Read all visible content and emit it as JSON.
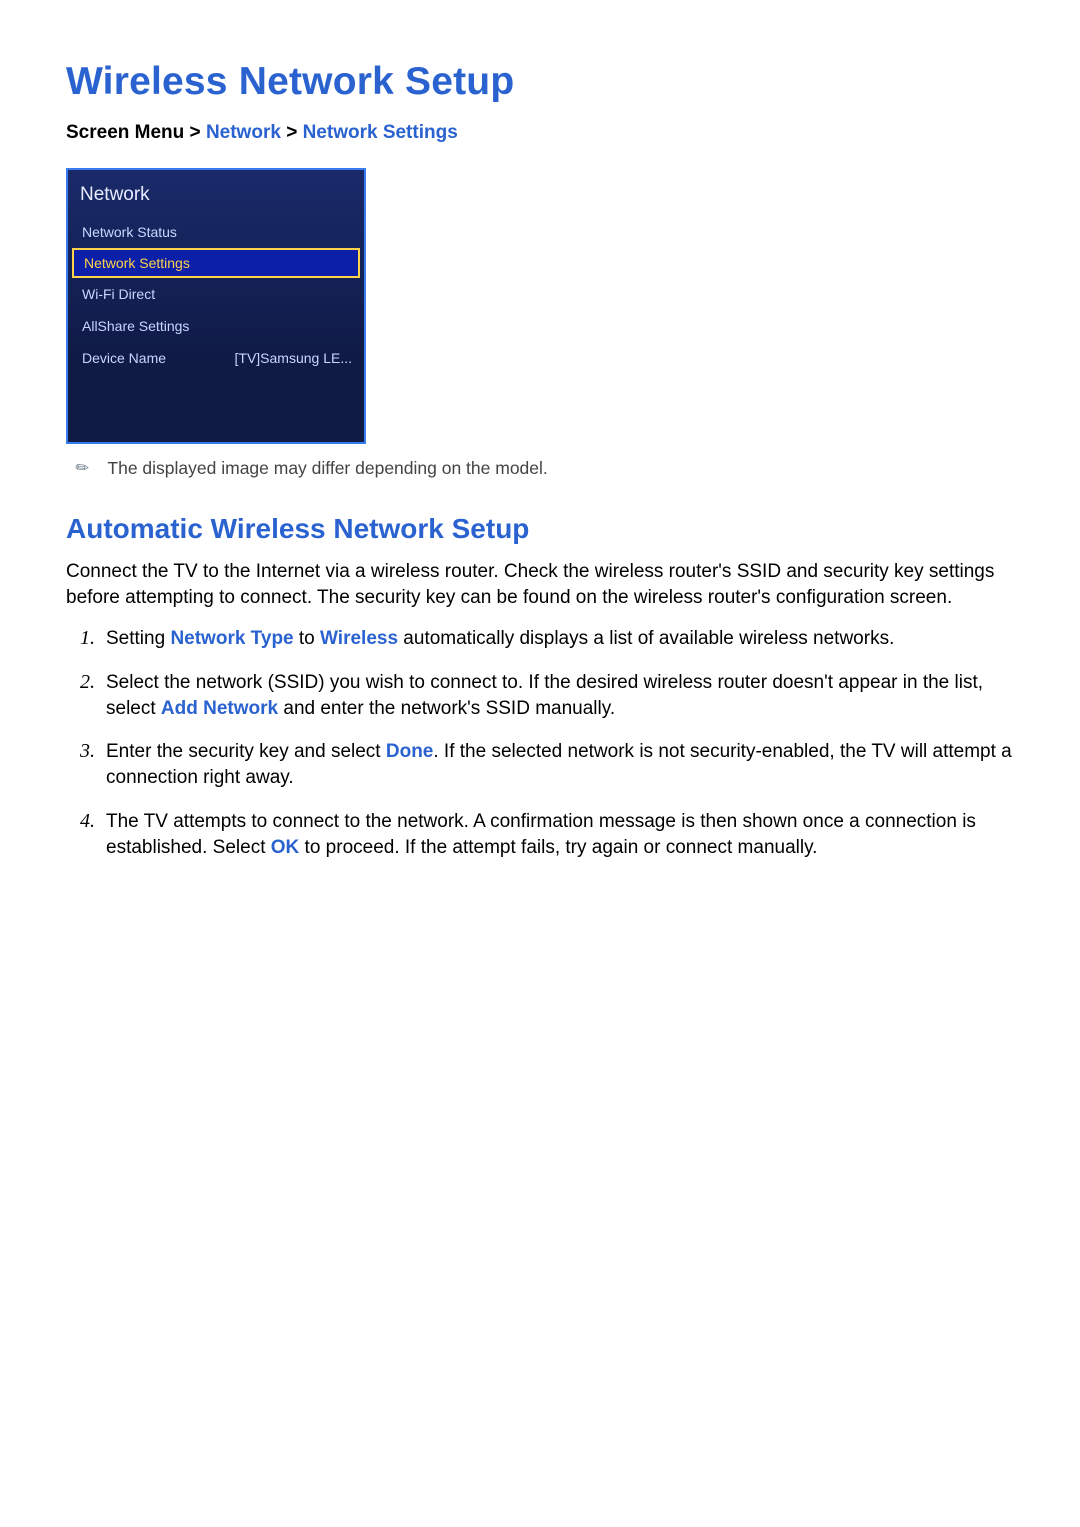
{
  "title": "Wireless Network Setup",
  "breadcrumb": {
    "prefix": "Screen Menu",
    "sep": ">",
    "item1": "Network",
    "item2": "Network Settings"
  },
  "menu": {
    "title": "Network",
    "items": [
      {
        "label": "Network Status",
        "value": "",
        "selected": false
      },
      {
        "label": "Network Settings",
        "value": "",
        "selected": true
      },
      {
        "label": "Wi-Fi Direct",
        "value": "",
        "selected": false
      },
      {
        "label": "AllShare Settings",
        "value": "",
        "selected": false
      },
      {
        "label": "Device Name",
        "value": "[TV]Samsung LE...",
        "selected": false
      }
    ]
  },
  "note_icon": "✎",
  "note": "The displayed image may differ depending on the model.",
  "subtitle": "Automatic Wireless Network Setup",
  "intro": "Connect the TV to the Internet via a wireless router. Check the wireless router's SSID and security key settings before attempting to connect. The security key can be found on the wireless router's configuration screen.",
  "steps": {
    "s1": {
      "t1": "Setting ",
      "h1": "Network Type",
      "t2": " to ",
      "h2": "Wireless",
      "t3": " automatically displays a list of available wireless networks."
    },
    "s2": {
      "t1": "Select the network (SSID) you wish to connect to. If the desired wireless router doesn't appear in the list, select ",
      "h1": "Add Network",
      "t2": " and enter the network's SSID manually."
    },
    "s3": {
      "t1": "Enter the security key and select ",
      "h1": "Done",
      "t2": ". If the selected network is not security-enabled, the TV will attempt a connection right away."
    },
    "s4": {
      "t1": "The TV attempts to connect to the network. A confirmation message is then shown once a connection is established. Select ",
      "h1": "OK",
      "t2": " to proceed. If the attempt fails, try again or connect manually."
    }
  }
}
